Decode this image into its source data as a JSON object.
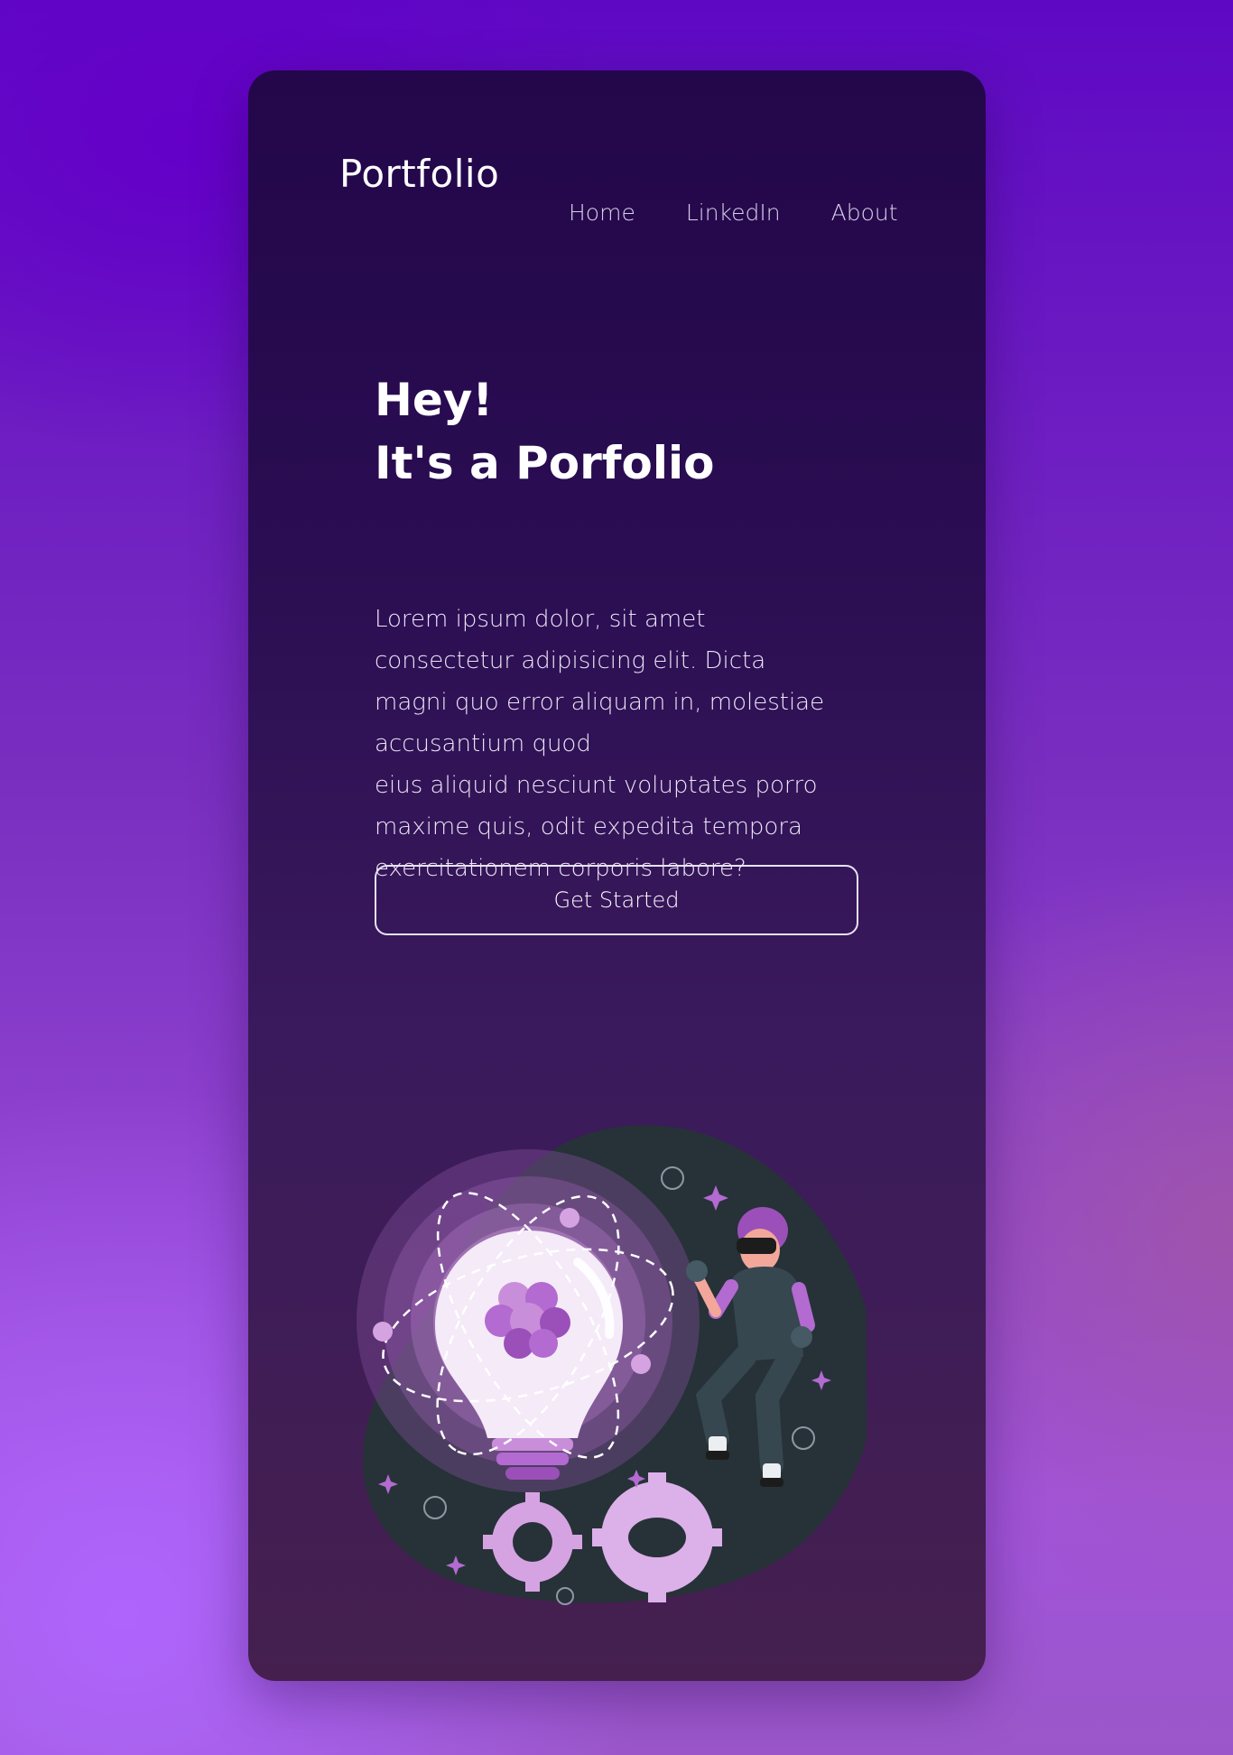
{
  "header": {
    "logo": "Portfolio",
    "nav": [
      {
        "label": "Home"
      },
      {
        "label": "LinkedIn"
      },
      {
        "label": "About"
      }
    ]
  },
  "hero": {
    "title_line1": "Hey!",
    "title_line2": "It's a Porfolio",
    "paragraph_lines": [
      "Lorem ipsum dolor, sit amet",
      "consectetur adipisicing elit. Dicta",
      "magni quo error aliquam in, molestiae",
      "accusantium quod",
      "eius aliquid nesciunt voluptates porro",
      "maxime quis, odit expedita tempora",
      "exercitationem corporis labore?"
    ],
    "cta_label": "Get Started"
  },
  "illustration": {
    "description_icon": "idea-lightbulb-vr-person-illustration"
  },
  "colors": {
    "accent": "#b36ad1",
    "card": "#2a0d52",
    "blob": "#263238"
  }
}
